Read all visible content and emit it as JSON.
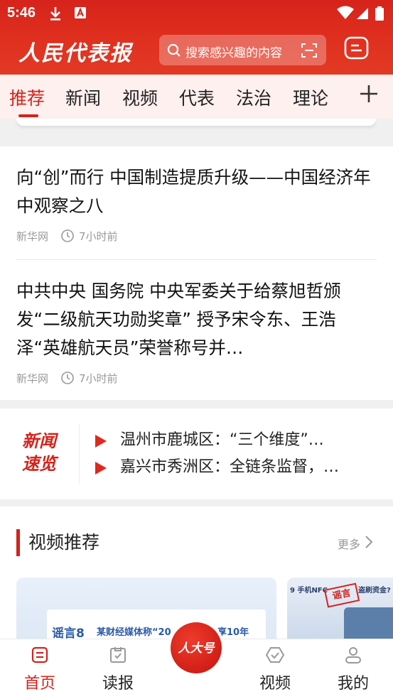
{
  "status_bar": {
    "time": "5:46"
  },
  "header": {
    "brand": "人民代表报",
    "search_placeholder": "搜索感兴趣的内容"
  },
  "tabs": [
    "推荐",
    "新闻",
    "视频",
    "代表",
    "法治",
    "理论"
  ],
  "articles": [
    {
      "title": "向“创”而行  中国制造提质升级——中国经济年中观察之八",
      "source": "新华网",
      "time": "7小时前"
    },
    {
      "title": "中共中央  国务院  中央军委关于给蔡旭哲颁发“二级航天功勋奖章”  授予宋令东、王浩泽“英雄航天员”荣誉称号并…",
      "source": "新华网",
      "time": "7小时前"
    }
  ],
  "news_flash": {
    "logo_line1": "新闻",
    "logo_line2": "速览",
    "items": [
      "温州市鹿城区：“三个维度”…",
      "嘉兴市秀洲区：全链条监督，…"
    ]
  },
  "video_section": {
    "title": "视频推荐",
    "more": "更多",
    "thumb1_tag": "谣言8",
    "thumb1_caption": "某财经媒体称“20",
    "thumb1_caption_end": "享10年",
    "thumb2_caption": "9  手机NFC",
    "thumb2_caption_end": "盗刷资金?",
    "thumb2_stamp": "谣言"
  },
  "bottom_nav": {
    "items": [
      "首页",
      "读报",
      "视频",
      "我的"
    ],
    "center": "人大号"
  },
  "colors": {
    "brand_red": "#d4231b"
  }
}
